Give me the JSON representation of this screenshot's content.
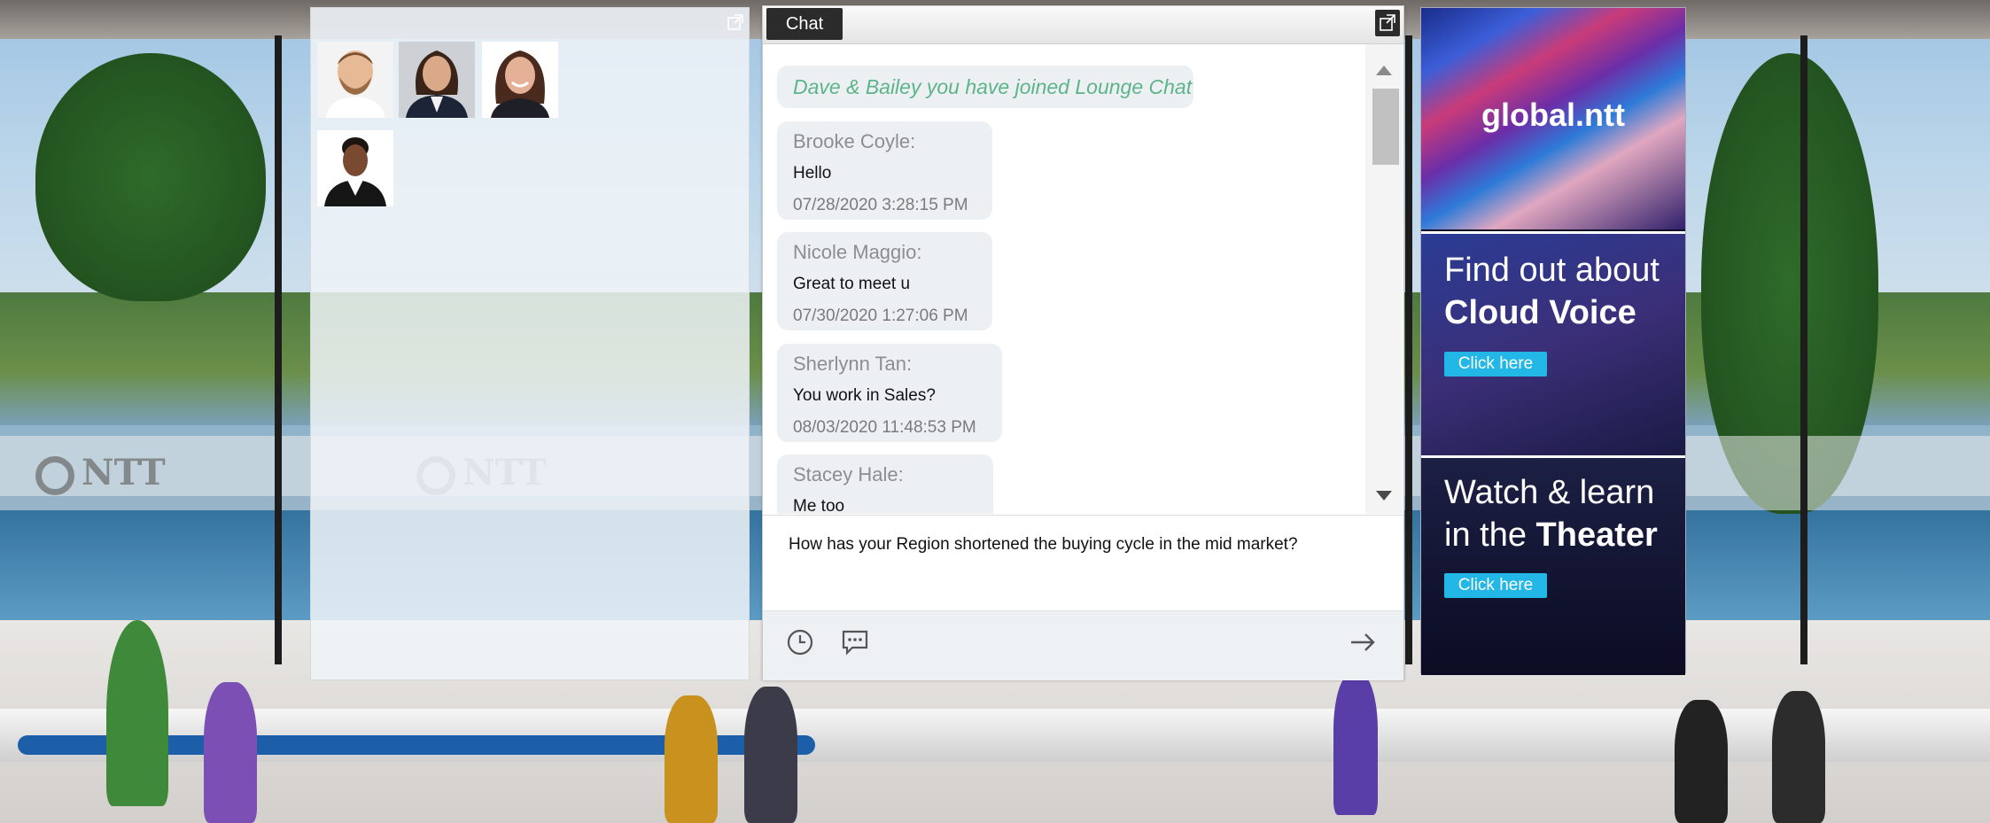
{
  "participants": {
    "popout_icon": "popout-icon",
    "avatars": [
      "avatar-man-beard",
      "avatar-woman-dark-hair",
      "avatar-woman-smiling",
      "avatar-woman-blazer"
    ]
  },
  "chat": {
    "tab_label": "Chat",
    "system_message": "Dave & Bailey you have joined Lounge Chat",
    "messages": [
      {
        "name": "Brooke Coyle:",
        "text": "Hello",
        "time": "07/28/2020 3:28:15 PM"
      },
      {
        "name": "Nicole Maggio:",
        "text": "Great to meet u",
        "time": "07/30/2020 1:27:06 PM"
      },
      {
        "name": "Sherlynn Tan:",
        "text": "You work in Sales?",
        "time": "08/03/2020 11:48:53 PM"
      },
      {
        "name": "Stacey Hale:",
        "text": "Me too",
        "time": ""
      }
    ],
    "composer_value": "How has your Region shortened the buying cycle in the mid market?",
    "footer_icons": [
      "clock-icon",
      "chat-bubble-icon",
      "send-arrow-icon"
    ]
  },
  "ads": {
    "ad1": {
      "logo": "global.ntt"
    },
    "ad2": {
      "line1": "Find out about",
      "line2": "Cloud Voice",
      "button": "Click here"
    },
    "ad3": {
      "line1": "Watch & learn",
      "line2_prefix": "in the ",
      "line2_bold": "Theater",
      "button": "Click here"
    }
  },
  "background": {
    "logo_text": "NTT"
  },
  "colors": {
    "accent_teal": "#22b7e6",
    "system_msg_green": "#5cb48a",
    "tab_dark": "#2b2b2b"
  }
}
